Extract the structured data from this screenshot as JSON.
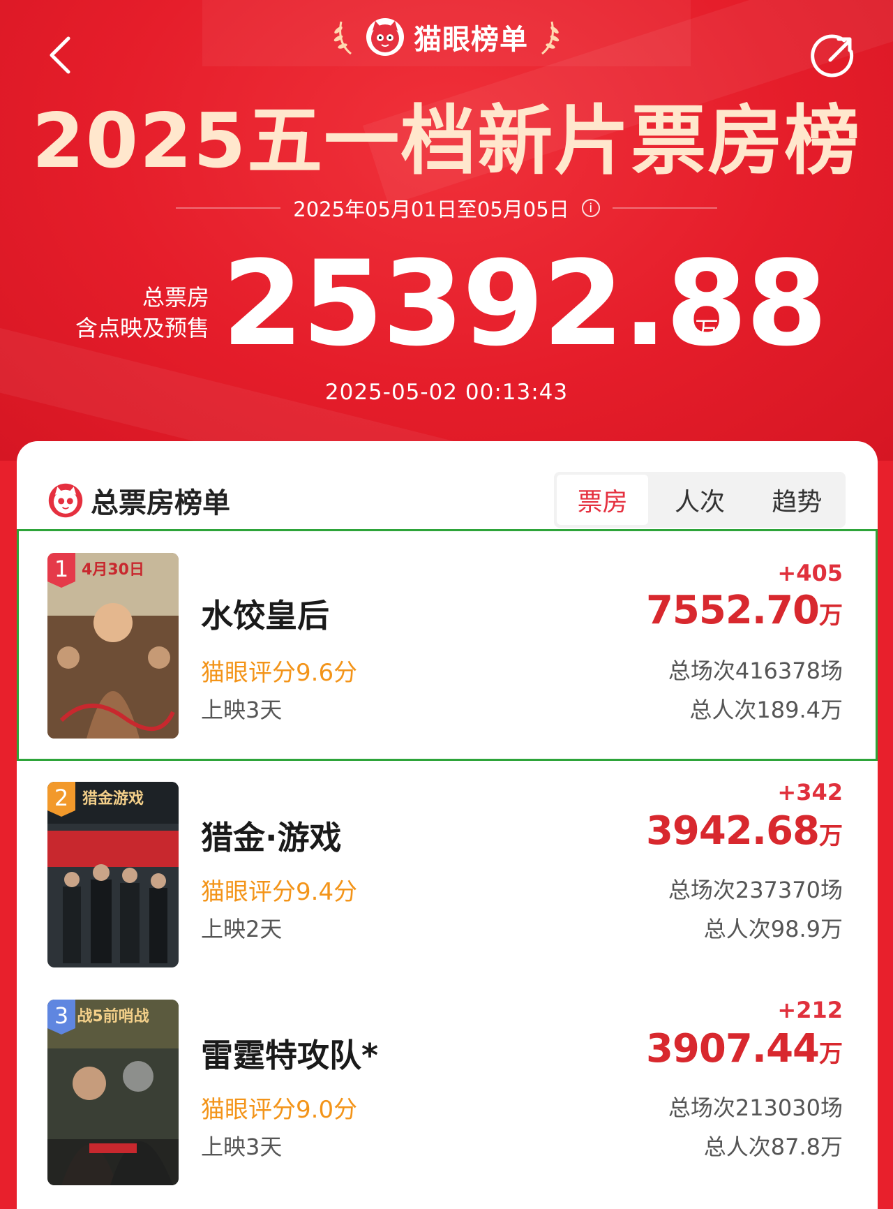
{
  "nav": {
    "back_icon": "chevron-left-icon",
    "share_icon": "share-icon"
  },
  "brand": {
    "name": "猫眼榜单",
    "logo_icon": "cat-logo-icon",
    "laurel_icon": "laurel-icon"
  },
  "headline": "2025五一档新片票房榜",
  "date_range": "2025年05月01日至05月05日",
  "total": {
    "label_line1": "总票房",
    "label_line2": "含点映及预售",
    "value": "25392.88",
    "unit": "万"
  },
  "timestamp": "2025-05-02  00:13:43",
  "board": {
    "title": "总票房榜单",
    "tabs": [
      {
        "label": "票房",
        "active": true
      },
      {
        "label": "人次",
        "active": false
      },
      {
        "label": "趋势",
        "active": false
      }
    ]
  },
  "movies": [
    {
      "rank": "1",
      "title": "水饺皇后",
      "score": "猫眼评分9.6分",
      "days": "上映3天",
      "delta": "+405",
      "gross": "7552.70",
      "gross_unit": "万",
      "shows": "总场次416378场",
      "viewers": "总人次189.4万",
      "poster_text": "4月30日",
      "badge_color": "#e53a4a"
    },
    {
      "rank": "2",
      "title": "猎金·游戏",
      "score": "猫眼评分9.4分",
      "days": "上映2天",
      "delta": "+342",
      "gross": "3942.68",
      "gross_unit": "万",
      "shows": "总场次237370场",
      "viewers": "总人次98.9万",
      "poster_text": "猎金游戏",
      "badge_color": "#f2992b"
    },
    {
      "rank": "3",
      "title": "雷霆特攻队*",
      "score": "猫眼评分9.0分",
      "days": "上映3天",
      "delta": "+212",
      "gross": "3907.44",
      "gross_unit": "万",
      "shows": "总场次213030场",
      "viewers": "总人次87.8万",
      "poster_text": "战5前哨战",
      "badge_color": "#5f86e0"
    }
  ]
}
